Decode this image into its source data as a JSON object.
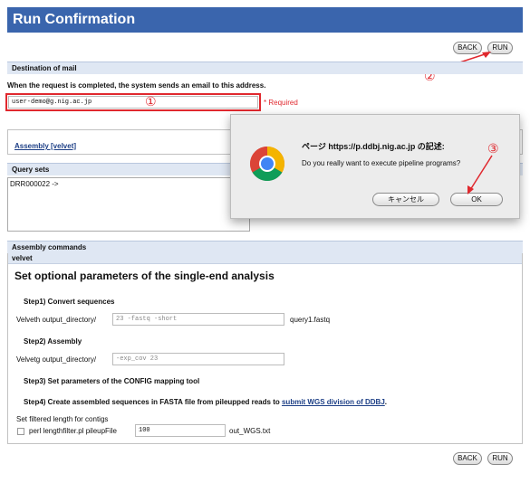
{
  "header": {
    "title": "Run Confirmation"
  },
  "buttons": {
    "back": "BACK",
    "run": "RUN"
  },
  "mail": {
    "section_title": "Destination of mail",
    "description": "When the request is completed, the system sends an email to this address.",
    "email_value": "user-demo@g.nig.ac.jp",
    "required": "* Required"
  },
  "callouts": {
    "one": "①",
    "two": "②",
    "three": "③"
  },
  "assembly_link": "Assembly [velvet]",
  "query": {
    "title": "Query sets",
    "value": "DRR000022 ->"
  },
  "dialog": {
    "title": "ページ https://p.ddbj.nig.ac.jp の記述:",
    "message": "Do you really want to execute pipeline programs?",
    "cancel": "キャンセル",
    "ok": "OK"
  },
  "commands": {
    "title": "Assembly commands",
    "tool": "velvet",
    "heading": "Set optional parameters of the single-end analysis",
    "step1": "Step1) Convert sequences",
    "velveth_label": "Velveth output_directory/",
    "velveth_value": "23 -fastq -short",
    "velveth_suffix": "query1.fastq",
    "step2": "Step2) Assembly",
    "velvetg_label": "Velvetg output_directory/",
    "velvetg_value": "-exp_cov 23",
    "step3": "Step3) Set parameters of the CONFIG mapping tool",
    "step4": "Step4) Create assembled sequences in FASTA file from pileupped reads to",
    "step4_link": "submit WGS division of DDBJ",
    "step4_end": ".",
    "filter_label": "Set filtered length for contigs",
    "perl_label": "perl lengthfilter.pl pileupFile",
    "perl_value": "100",
    "perl_suffix": "out_WGS.txt"
  }
}
